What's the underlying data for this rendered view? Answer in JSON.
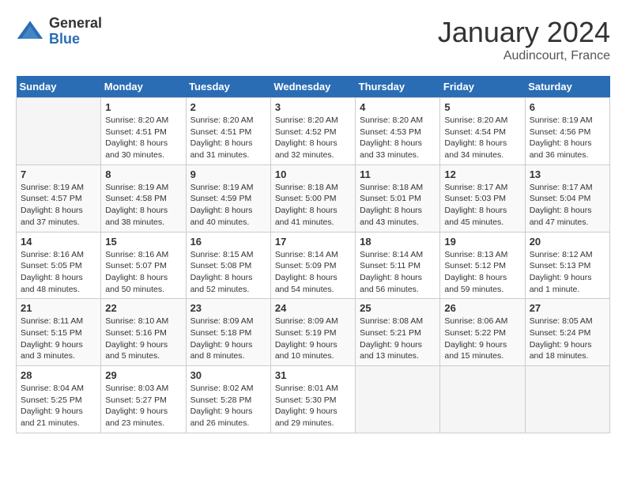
{
  "header": {
    "logo_general": "General",
    "logo_blue": "Blue",
    "month_title": "January 2024",
    "subtitle": "Audincourt, France"
  },
  "days_of_week": [
    "Sunday",
    "Monday",
    "Tuesday",
    "Wednesday",
    "Thursday",
    "Friday",
    "Saturday"
  ],
  "weeks": [
    [
      {
        "day": "",
        "empty": true
      },
      {
        "day": "1",
        "sunrise": "8:20 AM",
        "sunset": "4:51 PM",
        "daylight": "8 hours and 30 minutes."
      },
      {
        "day": "2",
        "sunrise": "8:20 AM",
        "sunset": "4:51 PM",
        "daylight": "8 hours and 31 minutes."
      },
      {
        "day": "3",
        "sunrise": "8:20 AM",
        "sunset": "4:52 PM",
        "daylight": "8 hours and 32 minutes."
      },
      {
        "day": "4",
        "sunrise": "8:20 AM",
        "sunset": "4:53 PM",
        "daylight": "8 hours and 33 minutes."
      },
      {
        "day": "5",
        "sunrise": "8:20 AM",
        "sunset": "4:54 PM",
        "daylight": "8 hours and 34 minutes."
      },
      {
        "day": "6",
        "sunrise": "8:19 AM",
        "sunset": "4:56 PM",
        "daylight": "8 hours and 36 minutes."
      }
    ],
    [
      {
        "day": "7",
        "sunrise": "8:19 AM",
        "sunset": "4:57 PM",
        "daylight": "8 hours and 37 minutes."
      },
      {
        "day": "8",
        "sunrise": "8:19 AM",
        "sunset": "4:58 PM",
        "daylight": "8 hours and 38 minutes."
      },
      {
        "day": "9",
        "sunrise": "8:19 AM",
        "sunset": "4:59 PM",
        "daylight": "8 hours and 40 minutes."
      },
      {
        "day": "10",
        "sunrise": "8:18 AM",
        "sunset": "5:00 PM",
        "daylight": "8 hours and 41 minutes."
      },
      {
        "day": "11",
        "sunrise": "8:18 AM",
        "sunset": "5:01 PM",
        "daylight": "8 hours and 43 minutes."
      },
      {
        "day": "12",
        "sunrise": "8:17 AM",
        "sunset": "5:03 PM",
        "daylight": "8 hours and 45 minutes."
      },
      {
        "day": "13",
        "sunrise": "8:17 AM",
        "sunset": "5:04 PM",
        "daylight": "8 hours and 47 minutes."
      }
    ],
    [
      {
        "day": "14",
        "sunrise": "8:16 AM",
        "sunset": "5:05 PM",
        "daylight": "8 hours and 48 minutes."
      },
      {
        "day": "15",
        "sunrise": "8:16 AM",
        "sunset": "5:07 PM",
        "daylight": "8 hours and 50 minutes."
      },
      {
        "day": "16",
        "sunrise": "8:15 AM",
        "sunset": "5:08 PM",
        "daylight": "8 hours and 52 minutes."
      },
      {
        "day": "17",
        "sunrise": "8:14 AM",
        "sunset": "5:09 PM",
        "daylight": "8 hours and 54 minutes."
      },
      {
        "day": "18",
        "sunrise": "8:14 AM",
        "sunset": "5:11 PM",
        "daylight": "8 hours and 56 minutes."
      },
      {
        "day": "19",
        "sunrise": "8:13 AM",
        "sunset": "5:12 PM",
        "daylight": "8 hours and 59 minutes."
      },
      {
        "day": "20",
        "sunrise": "8:12 AM",
        "sunset": "5:13 PM",
        "daylight": "9 hours and 1 minute."
      }
    ],
    [
      {
        "day": "21",
        "sunrise": "8:11 AM",
        "sunset": "5:15 PM",
        "daylight": "9 hours and 3 minutes."
      },
      {
        "day": "22",
        "sunrise": "8:10 AM",
        "sunset": "5:16 PM",
        "daylight": "9 hours and 5 minutes."
      },
      {
        "day": "23",
        "sunrise": "8:09 AM",
        "sunset": "5:18 PM",
        "daylight": "9 hours and 8 minutes."
      },
      {
        "day": "24",
        "sunrise": "8:09 AM",
        "sunset": "5:19 PM",
        "daylight": "9 hours and 10 minutes."
      },
      {
        "day": "25",
        "sunrise": "8:08 AM",
        "sunset": "5:21 PM",
        "daylight": "9 hours and 13 minutes."
      },
      {
        "day": "26",
        "sunrise": "8:06 AM",
        "sunset": "5:22 PM",
        "daylight": "9 hours and 15 minutes."
      },
      {
        "day": "27",
        "sunrise": "8:05 AM",
        "sunset": "5:24 PM",
        "daylight": "9 hours and 18 minutes."
      }
    ],
    [
      {
        "day": "28",
        "sunrise": "8:04 AM",
        "sunset": "5:25 PM",
        "daylight": "9 hours and 21 minutes."
      },
      {
        "day": "29",
        "sunrise": "8:03 AM",
        "sunset": "5:27 PM",
        "daylight": "9 hours and 23 minutes."
      },
      {
        "day": "30",
        "sunrise": "8:02 AM",
        "sunset": "5:28 PM",
        "daylight": "9 hours and 26 minutes."
      },
      {
        "day": "31",
        "sunrise": "8:01 AM",
        "sunset": "5:30 PM",
        "daylight": "9 hours and 29 minutes."
      },
      {
        "day": "",
        "empty": true
      },
      {
        "day": "",
        "empty": true
      },
      {
        "day": "",
        "empty": true
      }
    ]
  ]
}
